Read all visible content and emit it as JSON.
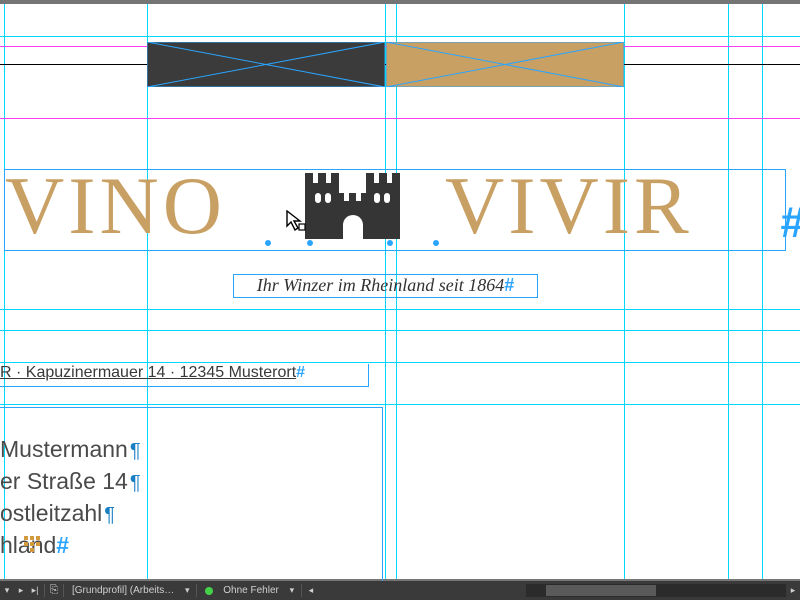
{
  "colors": {
    "brand_gold": "#c9a063",
    "guide_cyan": "#00d7ff",
    "margin_magenta": "#ff3df2",
    "castle": "#353535"
  },
  "header_rects": [
    {
      "name": "dark-rect",
      "fill": "#3b3b3b"
    },
    {
      "name": "tan-rect",
      "fill": "#c9a063"
    }
  ],
  "logo": {
    "left": "VINO",
    "right": "VIVIR",
    "overset": "#"
  },
  "tagline": {
    "text": "Ihr Winzer im Rheinland seit 1864",
    "end": "#"
  },
  "sender": {
    "text": "R · Kapuzinermauer 14 · 12345 Musterort",
    "end": "#"
  },
  "address": {
    "lines": [
      "Mustermann",
      "er Straße 14",
      "ostleitzahl",
      "hland"
    ],
    "end": "#"
  },
  "statusbar": {
    "profile": "[Grundprofil] (Arbeits…",
    "status": "Ohne Fehler"
  }
}
